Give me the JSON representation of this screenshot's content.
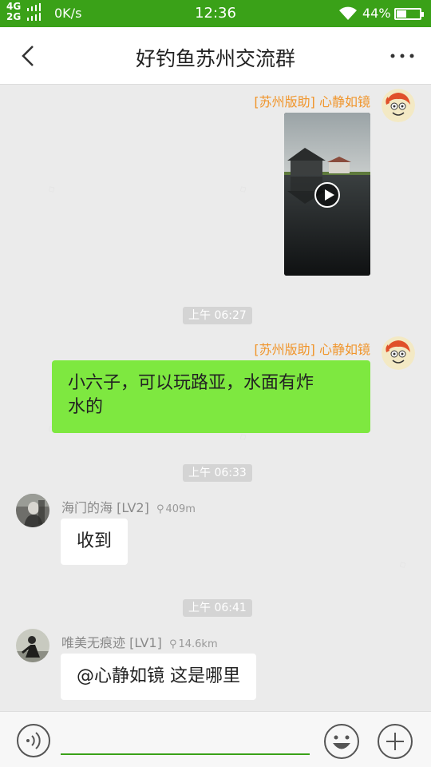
{
  "status_bar": {
    "net_top": "4G",
    "net_bottom": "2G",
    "speed": "0K/s",
    "time": "12:36",
    "battery": "44%",
    "battery_level": 0.44
  },
  "header": {
    "title": "好钓鱼苏州交流群",
    "back_icon": "chevron-left-icon",
    "more_icon": "more-dots-icon"
  },
  "messages": [
    {
      "sender": "[苏州版助] 心静如镜",
      "type": "video"
    },
    {
      "time": "上午 06:27"
    },
    {
      "sender": "[苏州版助] 心静如镜",
      "text_line1": "小六子，可以玩路亚，水面有炸",
      "text_line2": "水的"
    },
    {
      "time": "上午 06:33"
    },
    {
      "sender": "海门的海 [LV2]",
      "distance": "409m",
      "text": "收到"
    },
    {
      "time": "上午 06:41"
    },
    {
      "sender": "唯美无痕迹 [LV1]",
      "distance": "14.6km",
      "text": "@心静如镜 这是哪里"
    }
  ],
  "input_bar": {
    "placeholder": "",
    "value": ""
  },
  "colors": {
    "status_green": "#3aa118",
    "bubble_green": "#7ee840",
    "admin_orange": "#f0952b"
  }
}
